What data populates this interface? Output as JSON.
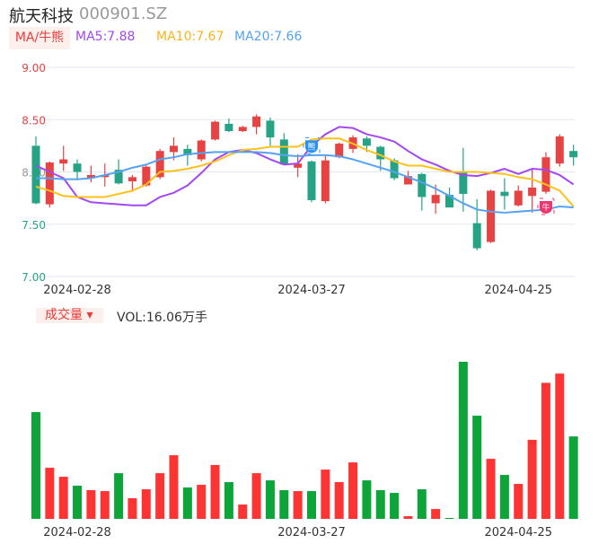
{
  "header": {
    "name": "航天科技",
    "code": "000901.SZ"
  },
  "indicators": {
    "ma_tag": "MA/牛熊",
    "ma5": "MA5:7.88",
    "ma10": "MA10:7.67",
    "ma20": "MA20:7.66"
  },
  "volume_panel": {
    "tag": "成交量 ▾",
    "vol": "VOL:16.06万手"
  },
  "colors": {
    "up": "#e84343",
    "down": "#26a384",
    "vol_up": "#fd3434",
    "vol_down": "#0da43a",
    "ma5": "#a347f0",
    "ma10": "#fcc21b",
    "ma20": "#55a2f2",
    "grid": "#e3e7f0"
  },
  "chart_data": [
    {
      "type": "candlestick",
      "title": "航天科技 000901.SZ",
      "ylim": [
        7.0,
        9.0
      ],
      "y_ticks": [
        "9.00",
        "8.50",
        "8.00",
        "7.50",
        "7.00"
      ],
      "x_tick_labels": [
        {
          "index": 3,
          "label": "2024-02-28"
        },
        {
          "index": 20,
          "label": "2024-03-27"
        },
        {
          "index": 35,
          "label": "2024-04-25"
        }
      ],
      "grid": true,
      "ohlc": [
        [
          8.25,
          8.34,
          7.69,
          7.7
        ],
        [
          7.69,
          8.1,
          7.66,
          8.09
        ],
        [
          8.08,
          8.25,
          8.01,
          8.12
        ],
        [
          8.08,
          8.12,
          7.92,
          8.0
        ],
        [
          7.94,
          8.06,
          7.9,
          7.97
        ],
        [
          7.95,
          8.08,
          7.86,
          7.97
        ],
        [
          8.02,
          8.12,
          7.88,
          7.89
        ],
        [
          7.91,
          7.97,
          7.81,
          7.95
        ],
        [
          7.87,
          8.06,
          7.86,
          8.05
        ],
        [
          7.95,
          8.22,
          7.93,
          8.2
        ],
        [
          8.19,
          8.33,
          8.11,
          8.25
        ],
        [
          8.22,
          8.26,
          8.06,
          8.16
        ],
        [
          8.12,
          8.31,
          8.1,
          8.3
        ],
        [
          8.31,
          8.49,
          8.3,
          8.48
        ],
        [
          8.46,
          8.51,
          8.38,
          8.39
        ],
        [
          8.39,
          8.44,
          8.38,
          8.43
        ],
        [
          8.43,
          8.55,
          8.36,
          8.53
        ],
        [
          8.49,
          8.52,
          8.25,
          8.33
        ],
        [
          8.31,
          8.37,
          8.07,
          8.07
        ],
        [
          8.04,
          8.17,
          7.95,
          8.08
        ],
        [
          8.1,
          8.11,
          7.71,
          7.73
        ],
        [
          7.72,
          8.16,
          7.7,
          8.11
        ],
        [
          8.14,
          8.28,
          8.13,
          8.27
        ],
        [
          8.22,
          8.35,
          8.18,
          8.33
        ],
        [
          8.32,
          8.34,
          8.19,
          8.25
        ],
        [
          8.24,
          8.25,
          8.01,
          8.12
        ],
        [
          8.11,
          8.13,
          7.92,
          7.94
        ],
        [
          7.88,
          8.01,
          7.88,
          7.96
        ],
        [
          7.98,
          7.99,
          7.63,
          7.76
        ],
        [
          7.7,
          7.88,
          7.6,
          7.78
        ],
        [
          7.78,
          7.85,
          7.66,
          7.66
        ],
        [
          8.0,
          8.23,
          7.62,
          7.79
        ],
        [
          7.51,
          7.74,
          7.25,
          7.27
        ],
        [
          7.33,
          7.83,
          7.32,
          7.82
        ],
        [
          7.81,
          7.94,
          7.64,
          7.77
        ],
        [
          7.68,
          7.87,
          7.67,
          7.82
        ],
        [
          7.77,
          8.03,
          7.61,
          7.85
        ],
        [
          7.81,
          8.19,
          7.79,
          8.14
        ],
        [
          8.08,
          8.36,
          8.05,
          8.34
        ],
        [
          8.2,
          8.26,
          8.06,
          8.14
        ]
      ],
      "ma5": [
        8.06,
        8.0,
        7.94,
        7.76,
        7.71,
        7.7,
        7.69,
        7.68,
        7.68,
        7.76,
        7.8,
        7.87,
        7.99,
        8.12,
        8.19,
        8.21,
        8.18,
        8.12,
        8.07,
        8.08,
        8.25,
        8.36,
        8.43,
        8.42,
        8.36,
        8.33,
        8.29,
        8.2,
        8.12,
        8.07,
        8.01,
        7.97,
        7.96,
        7.99,
        8.03,
        7.98,
        8.03,
        8.02,
        7.97,
        7.88
      ],
      "ma10": [
        7.86,
        7.82,
        7.77,
        7.76,
        7.76,
        7.76,
        7.79,
        7.82,
        7.88,
        8.0,
        8.01,
        8.03,
        8.06,
        8.1,
        8.16,
        8.21,
        8.22,
        8.24,
        8.24,
        8.24,
        8.31,
        8.32,
        8.32,
        8.27,
        8.21,
        8.16,
        8.1,
        8.06,
        8.06,
        8.03,
        8.0,
        8.0,
        8.0,
        7.99,
        7.98,
        7.95,
        7.93,
        7.88,
        7.82,
        7.67
      ],
      "ma20": [
        7.94,
        7.94,
        7.93,
        7.93,
        7.94,
        7.97,
        8.0,
        8.04,
        8.07,
        8.12,
        8.14,
        8.17,
        8.18,
        8.19,
        8.19,
        8.19,
        8.19,
        8.18,
        8.16,
        8.15,
        8.16,
        8.16,
        8.15,
        8.12,
        8.08,
        8.04,
        8.0,
        7.95,
        7.9,
        7.84,
        7.77,
        7.7,
        7.64,
        7.62,
        7.61,
        7.62,
        7.63,
        7.64,
        7.67,
        7.66
      ],
      "markers": [
        {
          "index": 20,
          "price": 8.25,
          "label": "熊",
          "color": "#2a8ff0"
        },
        {
          "index": 37,
          "price": 7.67,
          "label": "牛",
          "color": "#f0336a"
        }
      ]
    },
    {
      "type": "bar",
      "title": "成交量",
      "unit": "万手",
      "values": [
        20.8,
        9.95,
        8.2,
        6.46,
        5.59,
        5.41,
        8.9,
        4.02,
        5.76,
        8.9,
        12.4,
        6.11,
        6.63,
        10.5,
        7.16,
        2.79,
        8.9,
        7.5,
        5.59,
        5.41,
        5.41,
        9.6,
        7.16,
        11.0,
        7.5,
        5.59,
        5.06,
        0.52,
        5.76,
        1.92,
        0.17,
        30.6,
        20.1,
        11.7,
        8.56,
        6.81,
        15.4,
        26.5,
        28.3,
        16.06
      ],
      "x_tick_labels": [
        {
          "index": 3,
          "label": "2024-02-28"
        },
        {
          "index": 20,
          "label": "2024-03-27"
        },
        {
          "index": 35,
          "label": "2024-04-25"
        }
      ]
    }
  ]
}
